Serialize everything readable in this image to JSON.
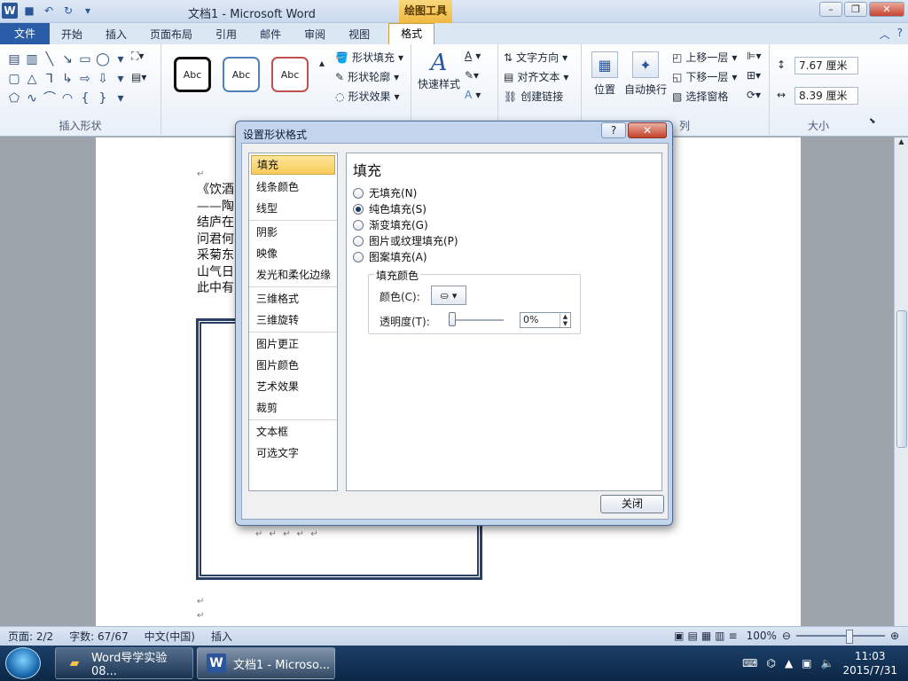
{
  "titlebar": {
    "title": "文档1 - Microsoft Word",
    "context_tab": "绘图工具"
  },
  "tabs": [
    "文件",
    "开始",
    "插入",
    "页面布局",
    "引用",
    "邮件",
    "审阅",
    "视图",
    "格式"
  ],
  "ribbon": {
    "shape_style_samples": [
      "Abc",
      "Abc",
      "Abc"
    ],
    "insert_shapes_label": "插入形状",
    "shape_fill": "形状填充",
    "shape_outline": "形状轮廓",
    "shape_effects": "形状效果",
    "quick_styles": "快速样式",
    "text_direction": "文字方向",
    "align_text": "对齐文本",
    "create_link": "创建链接",
    "position": "位置",
    "wrap_text": "自动换行",
    "bring_forward": "上移一层",
    "send_backward": "下移一层",
    "selection_pane": "选择窗格",
    "arrange_label_fragment": "列",
    "height_value": "7.67 厘米",
    "width_value": "8.39 厘米",
    "size_label": "大小"
  },
  "document": {
    "poem_lines": [
      "《饮酒",
      "——陶",
      "结庐在",
      "问君何",
      "采菊东",
      "山气日",
      "此中有"
    ],
    "para_mark": "↵",
    "table_marks": "↵  ↵  ↵  ↵  ↵"
  },
  "dialog": {
    "title": "设置形状格式",
    "help": "?",
    "close_x": "✕",
    "nav": [
      "填充",
      "线条颜色",
      "线型",
      "阴影",
      "映像",
      "发光和柔化边缘",
      "三维格式",
      "三维旋转",
      "图片更正",
      "图片颜色",
      "艺术效果",
      "裁剪",
      "文本框",
      "可选文字"
    ],
    "selected_nav": "填充",
    "pane_title": "填充",
    "options": [
      "无填充(N)",
      "纯色填充(S)",
      "渐变填充(G)",
      "图片或纹理填充(P)",
      "图案填充(A)"
    ],
    "selected_option": 1,
    "fill_color_legend": "填充颜色",
    "color_label": "颜色(C):",
    "transparency_label": "透明度(T):",
    "transparency_value": "0%",
    "close_button": "关闭"
  },
  "statusbar": {
    "page": "页面: 2/2",
    "words": "字数: 67/67",
    "lang": "中文(中国)",
    "mode": "插入",
    "zoom": "100%"
  },
  "taskbar": {
    "items": [
      "Word导学实验08...",
      "文档1 - Microso..."
    ],
    "time": "11:03",
    "date": "2015/7/31"
  }
}
